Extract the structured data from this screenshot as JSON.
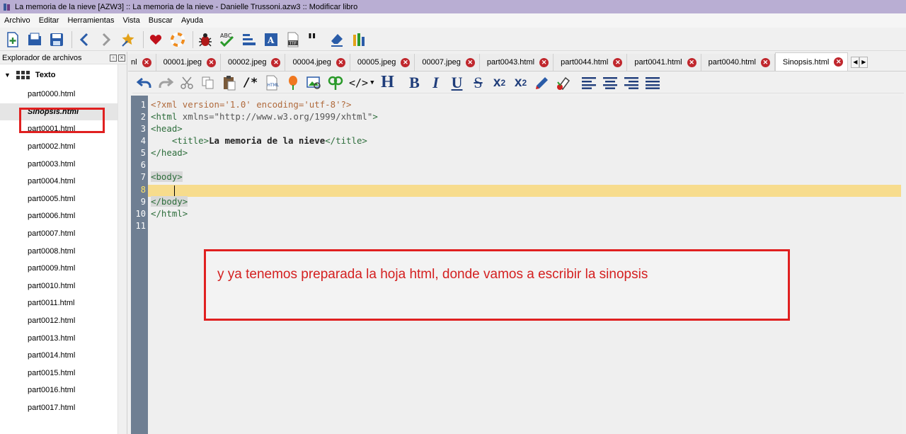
{
  "window": {
    "title": "La memoria de la nieve [AZW3] :: La memoria de la nieve - Danielle Trussoni.azw3 :: Modificar libro",
    "titlebar_color": "#b9aed3"
  },
  "menu": {
    "items": [
      {
        "label": "Archivo"
      },
      {
        "label": "Editar"
      },
      {
        "label": "Herramientas"
      },
      {
        "label": "Vista"
      },
      {
        "label": "Buscar"
      },
      {
        "label": "Ayuda"
      }
    ]
  },
  "toolbar": {
    "icons": [
      "new-file-icon",
      "open-folder-icon",
      "save-icon",
      "back-icon",
      "forward-icon",
      "checkpoint-icon",
      "heart-icon",
      "lifebuoy-icon",
      "bug-icon",
      "spellcheck-icon",
      "sort-icon",
      "dictionary-icon",
      "font-icon",
      "quote-icon",
      "eraser-icon",
      "reports-icon"
    ]
  },
  "sidebar": {
    "header": "Explorador de archivos",
    "root_label": "Texto",
    "files": [
      {
        "label": "part0000.html"
      },
      {
        "label": "Sinopsis.html"
      },
      {
        "label": "part0001.html"
      },
      {
        "label": "part0002.html"
      },
      {
        "label": "part0003.html"
      },
      {
        "label": "part0004.html"
      },
      {
        "label": "part0005.html"
      },
      {
        "label": "part0006.html"
      },
      {
        "label": "part0007.html"
      },
      {
        "label": "part0008.html"
      },
      {
        "label": "part0009.html"
      },
      {
        "label": "part0010.html"
      },
      {
        "label": "part0011.html"
      },
      {
        "label": "part0012.html"
      },
      {
        "label": "part0013.html"
      },
      {
        "label": "part0014.html"
      },
      {
        "label": "part0015.html"
      },
      {
        "label": "part0016.html"
      },
      {
        "label": "part0017.html"
      }
    ],
    "selected_file": "Sinopsis.html"
  },
  "tabs": [
    {
      "label": "nl"
    },
    {
      "label": "00001.jpeg"
    },
    {
      "label": "00002.jpeg"
    },
    {
      "label": "00004.jpeg"
    },
    {
      "label": "00005.jpeg"
    },
    {
      "label": "00007.jpeg"
    },
    {
      "label": "part0043.html"
    },
    {
      "label": "part0044.html"
    },
    {
      "label": "part0041.html"
    },
    {
      "label": "part0040.html"
    },
    {
      "label": "Sinopsis.html"
    }
  ],
  "active_tab": "Sinopsis.html",
  "format_bar": {
    "buttons": [
      "undo",
      "redo",
      "cut",
      "copy",
      "paste",
      "comment",
      "html-insert",
      "tag-insert",
      "image-insert",
      "link-insert",
      "tag-menu",
      "heading",
      "bold",
      "italic",
      "underline",
      "strikethrough",
      "subscript",
      "superscript",
      "color",
      "background-color",
      "align-left",
      "align-center",
      "align-right",
      "justify"
    ]
  },
  "code": {
    "lines": [
      {
        "num": "1",
        "text": "<?xml version='1.0' encoding='utf-8'?>"
      },
      {
        "num": "2",
        "text": "<html xmlns=\"http://www.w3.org/1999/xhtml\">"
      },
      {
        "num": "3",
        "text": "<head>"
      },
      {
        "num": "4",
        "text": "    <title>La memoria de la nieve</title>"
      },
      {
        "num": "5",
        "text": "</head>"
      },
      {
        "num": "6",
        "text": ""
      },
      {
        "num": "7",
        "text": "<body>"
      },
      {
        "num": "8",
        "text": "    "
      },
      {
        "num": "9",
        "text": "</body>"
      },
      {
        "num": "10",
        "text": "</html>"
      },
      {
        "num": "11",
        "text": ""
      }
    ],
    "current_line": "8",
    "current_line_color": "#f7dc8d"
  },
  "annotation": {
    "text": "y ya tenemos preparada la hoja html, donde vamos a escribir la sinopsis",
    "color": "#d42020"
  }
}
